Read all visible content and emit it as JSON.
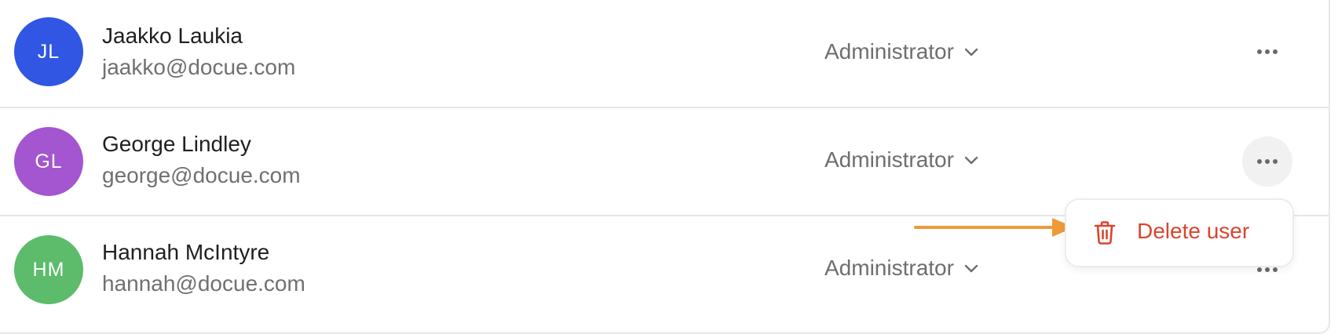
{
  "users": [
    {
      "initials": "JL",
      "name": "Jaakko Laukia",
      "email": "jaakko@docue.com",
      "role": "Administrator",
      "avatar_color": "#3056e3"
    },
    {
      "initials": "GL",
      "name": "George Lindley",
      "email": "george@docue.com",
      "role": "Administrator",
      "avatar_color": "#a356cf"
    },
    {
      "initials": "HM",
      "name": "Hannah McIntyre",
      "email": "hannah@docue.com",
      "role": "Administrator",
      "avatar_color": "#5cbc6b"
    }
  ],
  "context_menu": {
    "delete_label": "Delete user",
    "danger_color": "#d9452f"
  },
  "annotation": {
    "arrow_color": "#ef9a37"
  },
  "icons": {
    "more": "more-horizontal-icon",
    "chevron": "chevron-down-icon",
    "trash": "trash-icon"
  }
}
